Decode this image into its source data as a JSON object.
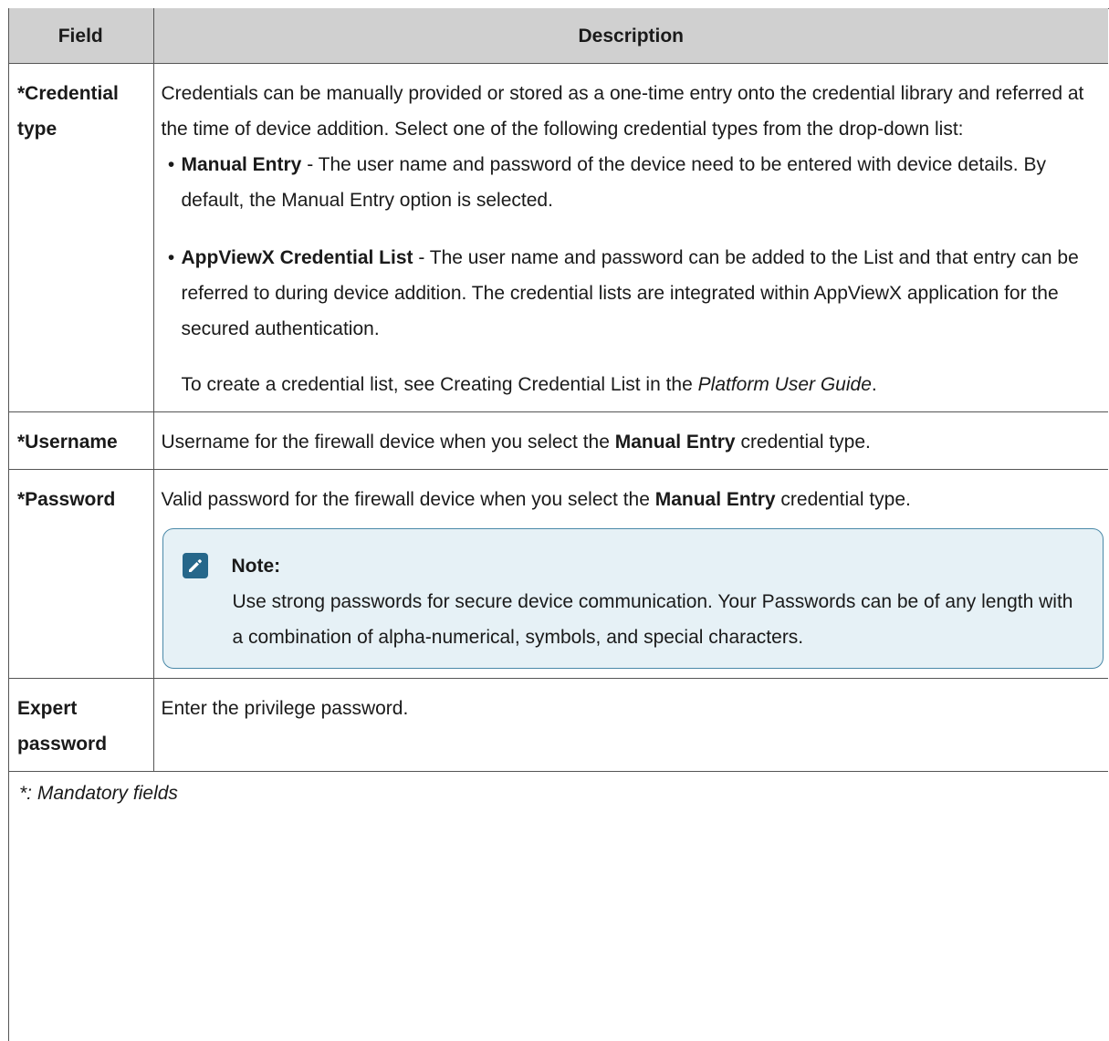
{
  "page": {
    "section_title": "Description"
  },
  "table": {
    "headers": {
      "field": "Field",
      "description": "Description"
    },
    "rows": {
      "credential_type": {
        "field": "*Credential type",
        "intro": "Credentials can be manually provided or stored as a one-time entry onto the credential library and referred at the time of device addition. Select one of the following credential types from the drop-down list:",
        "option1_bold": "Manual Entry",
        "option1_text": " - The user name and password of the device need to be entered with device details. By default, the Manual Entry option is selected.",
        "option2_bold": "AppViewX Credential List",
        "option2_text": " - The user name and password can be added to the List and that entry can be referred to during device addition. The credential lists are integrated within AppViewX application for the secured authentication.",
        "sub_text_before": "To create a credential list, see Creating Credential List in the ",
        "sub_text_italic": "Platform User Guide",
        "sub_text_after": "."
      },
      "username": {
        "field": "*Username",
        "text_before": "Username for the firewall device when you select the ",
        "text_bold": "Manual Entry",
        "text_after": " credential type."
      },
      "password": {
        "field": "*Password",
        "text_before": "Valid password for the firewall device when you select the ",
        "text_bold": "Manual Entry",
        "text_after": " credential type.",
        "note_icon": "pencil-icon",
        "note_title": "Note:",
        "note_body": "Use strong passwords for secure device communication. Your Passwords can be of any length with a combination of alpha-numerical, symbols, and special characters."
      },
      "expert_password": {
        "field": "Expert password",
        "text": "Enter the privilege password."
      }
    },
    "footer": "*: Mandatory fields"
  },
  "colors": {
    "header_bg": "#d0d0d0",
    "border": "#555555",
    "note_bg": "#e6f1f6",
    "note_border": "#4a89a8",
    "note_icon_bg": "#26678a"
  }
}
